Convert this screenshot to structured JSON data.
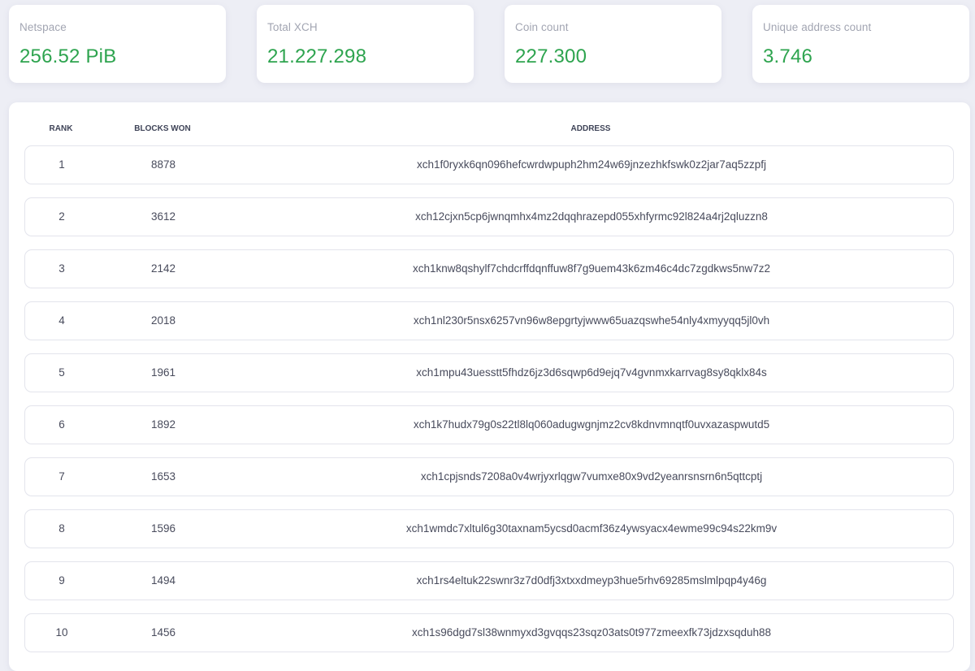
{
  "colors": {
    "page_background": "#edeef5",
    "card_background": "#ffffff",
    "stat_value": "#2ea44f",
    "stat_label": "#a2a5b2",
    "row_border": "#e3e4ec",
    "text": "#484b5c"
  },
  "stats": [
    {
      "label": "Netspace",
      "value": "256.52 PiB"
    },
    {
      "label": "Total XCH",
      "value": "21.227.298"
    },
    {
      "label": "Coin count",
      "value": "227.300"
    },
    {
      "label": "Unique address count",
      "value": "3.746"
    }
  ],
  "table": {
    "headers": {
      "rank": "RANK",
      "blocks_won": "BLOCKS WON",
      "address": "ADDRESS"
    },
    "rows": [
      {
        "rank": "1",
        "blocks_won": "8878",
        "address": "xch1f0ryxk6qn096hefcwrdwpuph2hm24w69jnzezhkfswk0z2jar7aq5zzpfj"
      },
      {
        "rank": "2",
        "blocks_won": "3612",
        "address": "xch12cjxn5cp6jwnqmhx4mz2dqqhrazepd055xhfyrmc92l824a4rj2qluzzn8"
      },
      {
        "rank": "3",
        "blocks_won": "2142",
        "address": "xch1knw8qshylf7chdcrffdqnffuw8f7g9uem43k6zm46c4dc7zgdkws5nw7z2"
      },
      {
        "rank": "4",
        "blocks_won": "2018",
        "address": "xch1nl230r5nsx6257vn96w8epgrtyjwww65uazqswhe54nly4xmyyqq5jl0vh"
      },
      {
        "rank": "5",
        "blocks_won": "1961",
        "address": "xch1mpu43uesstt5fhdz6jz3d6sqwp6d9ejq7v4gvnmxkarrvag8sy8qklx84s"
      },
      {
        "rank": "6",
        "blocks_won": "1892",
        "address": "xch1k7hudx79g0s22tl8lq060adugwgnjmz2cv8kdnvmnqtf0uvxazaspwutd5"
      },
      {
        "rank": "7",
        "blocks_won": "1653",
        "address": "xch1cpjsnds7208a0v4wrjyxrlqgw7vumxe80x9vd2yeanrsnsrn6n5qttcptj"
      },
      {
        "rank": "8",
        "blocks_won": "1596",
        "address": "xch1wmdc7xltul6g30taxnam5ycsd0acmf36z4ywsyacx4ewme99c94s22km9v"
      },
      {
        "rank": "9",
        "blocks_won": "1494",
        "address": "xch1rs4eltuk22swnr3z7d0dfj3xtxxdmeyp3hue5rhv69285mslmlpqp4y46g"
      },
      {
        "rank": "10",
        "blocks_won": "1456",
        "address": "xch1s96dgd7sl38wnmyxd3gvqqs23sqz03ats0t977zmeexfk73jdzxsqduh88"
      }
    ]
  }
}
